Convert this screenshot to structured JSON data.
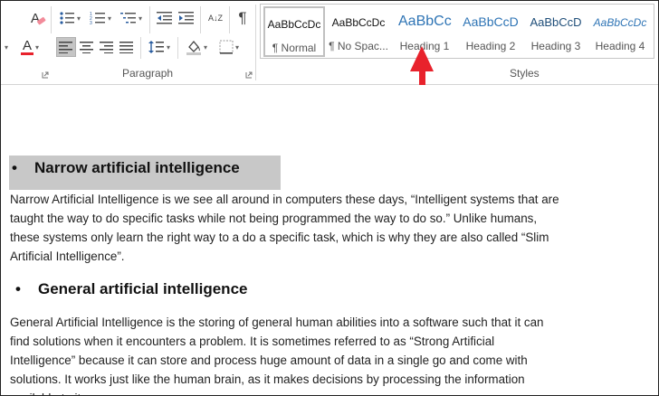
{
  "ribbon": {
    "paragraph_group_label": "Paragraph",
    "styles_group_label": "Styles",
    "styles": [
      {
        "sample": "AaBbCcDc",
        "name": "¶ Normal",
        "color": "#111111"
      },
      {
        "sample": "AaBbCcDc",
        "name": "¶ No Spac...",
        "color": "#111111"
      },
      {
        "sample": "AaBbCc",
        "name": "Heading 1",
        "color": "#2e74b5"
      },
      {
        "sample": "AaBbCcD",
        "name": "Heading 2",
        "color": "#2e74b5"
      },
      {
        "sample": "AaBbCcD",
        "name": "Heading 3",
        "color": "#1f4e79"
      },
      {
        "sample": "AaBbCcDc",
        "name": "Heading 4",
        "color": "#2e74b5"
      }
    ],
    "icons": {
      "clear_format": "clear-formatting-icon",
      "bullets": "bullets-icon",
      "numbering": "numbering-icon",
      "multilevel": "multilevel-list-icon",
      "decrease_indent": "decrease-indent-icon",
      "increase_indent": "increase-indent-icon",
      "sort": "sort-icon",
      "show_marks": "pilcrow-icon",
      "font_color": "font-color-icon",
      "align_left": "align-left-icon",
      "align_center": "align-center-icon",
      "align_right": "align-right-icon",
      "justify": "justify-icon",
      "line_spacing": "line-spacing-icon",
      "shading": "shading-icon",
      "borders": "borders-icon"
    },
    "glyphs": {
      "sort": "A↓Z",
      "pilcrow": "¶",
      "font_color_letter": "A",
      "clear_format": "A"
    },
    "accent_red": "#e8222c"
  },
  "document": {
    "sections": [
      {
        "bullet": "•",
        "heading": "Narrow artificial intelligence",
        "body": " Narrow Artificial Intelligence is we see all around in computers these days, “Intelligent systems that are taught the way to do specific tasks while not being programmed the way to do so.” Unlike humans, these systems only learn the right way to a do a specific task, which is why they are also called “Slim Artificial Intelligence”."
      },
      {
        "bullet": "•",
        "heading": "General artificial intelligence",
        "body": "General Artificial Intelligence is the storing of general human abilities into a software such that it can find solutions when it encounters a problem. It is sometimes referred to as “Strong Artificial Intelligence” because it can store and process huge amount of data in a single go and come with solutions. It works just like the human brain, as it makes decisions by processing the information available to it."
      }
    ],
    "highlight_color": "#c8c8c8"
  }
}
